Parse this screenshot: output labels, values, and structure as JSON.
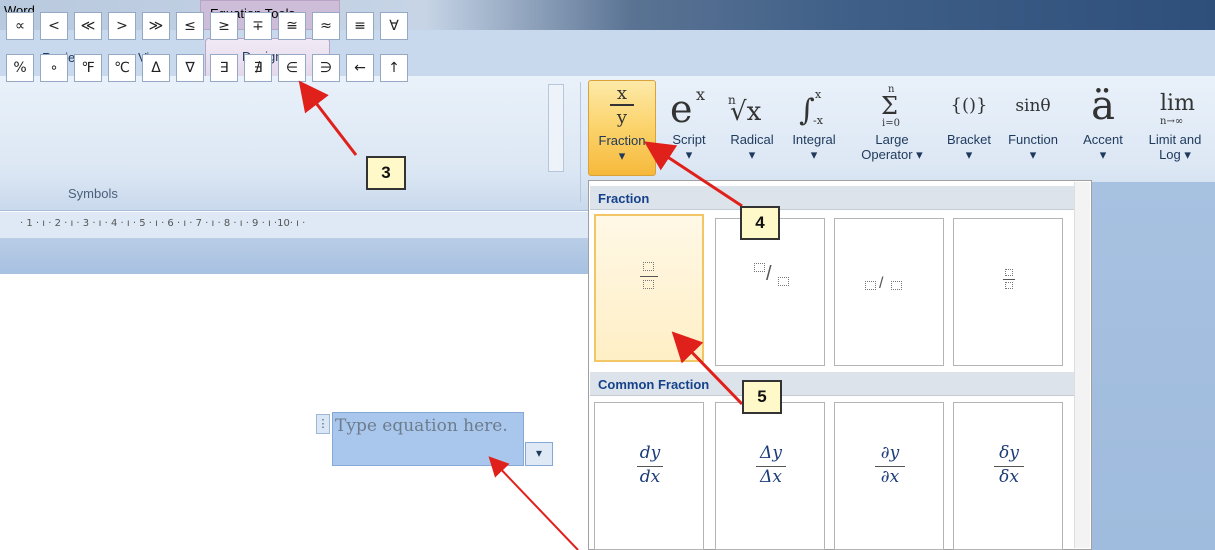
{
  "titlebar": {
    "app_name": "Word",
    "context_tools": "Equation Tools"
  },
  "tabs": [
    {
      "label": "Review"
    },
    {
      "label": "View"
    },
    {
      "label": "Design"
    }
  ],
  "symbols": {
    "row1": [
      "∝",
      "<",
      "≪",
      ">",
      "≫",
      "≤",
      "≥",
      "∓",
      "≅",
      "≈",
      "≡",
      "∀"
    ],
    "row2": [
      "%",
      "∘",
      "℉",
      "℃",
      "Δ",
      "∇",
      "∃",
      "∄",
      "∈",
      "∋",
      "←",
      "↑"
    ],
    "group_label": "Symbols"
  },
  "structures": [
    {
      "label1": "Fraction",
      "label2": "▾"
    },
    {
      "label1": "Script",
      "label2": "▾"
    },
    {
      "label1": "Radical",
      "label2": "▾"
    },
    {
      "label1": "Integral",
      "label2": "▾"
    },
    {
      "label1": "Large",
      "label2": "Operator ▾"
    },
    {
      "label1": "Bracket",
      "label2": "▾"
    },
    {
      "label1": "Function",
      "label2": "▾"
    },
    {
      "label1": "Accent",
      "label2": "▾"
    },
    {
      "label1": "Limit and",
      "label2": "Log ▾"
    }
  ],
  "ruler": "· 1 · ı · 2 · ı · 3 · ı · 4 · ı · 5 · ı · 6 · ı · 7 · ı · 8 · ı · 9 · ı ·10· ı ·",
  "equation": {
    "placeholder": "Type equation here.",
    "dropdown_glyph": "▾"
  },
  "gallery": {
    "section1": "Fraction",
    "section2": "Common Fraction",
    "common": [
      {
        "num": "dy",
        "den": "dx"
      },
      {
        "num": "Δy",
        "den": "Δx"
      },
      {
        "num": "∂y",
        "den": "∂x"
      },
      {
        "num": "δy",
        "den": "δx"
      }
    ]
  },
  "callouts": [
    "3",
    "4",
    "5"
  ]
}
